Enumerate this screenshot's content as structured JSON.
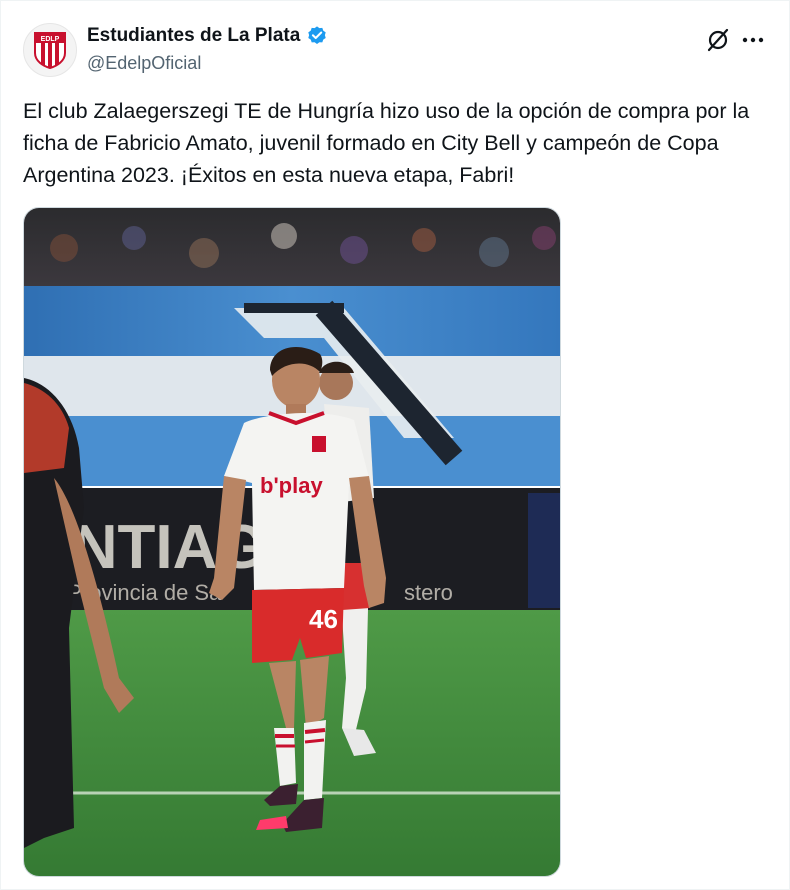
{
  "author": {
    "display_name": "Estudiantes de La Plata",
    "handle": "@EdelpOficial",
    "avatar_icon": "club-crest-icon",
    "avatar_crest_text": "EDLP",
    "verified_icon": "verified-badge-icon",
    "verified_color": "#1d9bf0"
  },
  "actions": {
    "grok_icon": "grok-icon",
    "more_icon": "more-options-icon"
  },
  "tweet": {
    "text": "El club Zalaegerszegi TE de Hungría hizo uso de la opción de compra por la ficha de Fabricio Amato, juvenil formado en City Bell y campeón de Copa Argentina 2023. ¡Éxitos en esta nueva etapa, Fabri!"
  },
  "media": {
    "alt": "photo",
    "sponsor_text": "b'play",
    "shirt_number": "46",
    "board_text": "ANTIAG",
    "board_subtext": "la Provincia de Sa",
    "board_subtext_right": "stero",
    "colors": {
      "jersey_white": "#f4f4f2",
      "shorts_red": "#d92b2b",
      "pitch_green": "#3f8d3e",
      "banner_blue": "#3d7fc1"
    }
  }
}
